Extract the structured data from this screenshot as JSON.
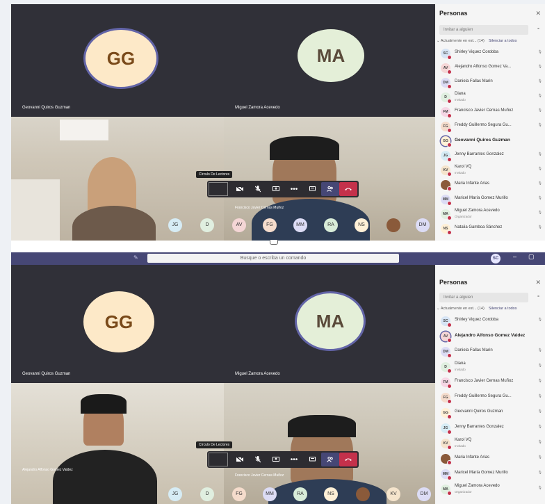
{
  "screenshot_top": {
    "tiles": [
      {
        "initials": "GG",
        "name": "Geovanni Quiros Guzman"
      },
      {
        "initials": "MA",
        "name": "Miguel Zamora Acevedo"
      }
    ],
    "camera_names": {
      "right": "Francisco Javier Cernas Muñoz"
    },
    "tooltip": "Círculo De Lectores",
    "strip": [
      "JG",
      "D",
      "AV",
      "FG",
      "MM",
      "RA",
      "NS",
      "DM"
    ]
  },
  "screenshot_bottom": {
    "search_placeholder": "Busque o escriba un comando",
    "me_initials": "SC",
    "tiles": [
      {
        "initials": "GG",
        "name": "Geovanni Quiros Guzman"
      },
      {
        "initials": "MA",
        "name": "Miguel Zamora Acevedo"
      }
    ],
    "camera_names": {
      "left": "Alejandro Alfonso Gomez Valdez",
      "right": "Francisco Javier Cernas Muñoz"
    },
    "tooltip": "Círculo De Lectores",
    "strip": [
      "JG",
      "D",
      "FG",
      "MM",
      "RA",
      "NS",
      "KV",
      "DM"
    ]
  },
  "panel": {
    "title": "Personas",
    "invite_placeholder": "Invitar a alguien",
    "section": "Actualmente en est... (14)",
    "mute_all": "Silenciar a todos",
    "top_people": [
      {
        "initials": "SC",
        "name": "Shirley Viquez Cordoba",
        "color": "#d6e4f5"
      },
      {
        "initials": "AV",
        "name": "Alejandro Alfonso Gomez Va...",
        "color": "#f5d6d6"
      },
      {
        "initials": "DM",
        "name": "Daniela Fallas Marin",
        "color": "#dcdcf5"
      },
      {
        "initials": "D",
        "name": "Diana",
        "sub": "Invitado",
        "color": "#e0efe0"
      },
      {
        "initials": "FM",
        "name": "Francisco Javier Cernas Muñoz",
        "color": "#f5d6e4"
      },
      {
        "initials": "FG",
        "name": "Freddy Guillermo Segura Gu...",
        "color": "#f5dccc"
      },
      {
        "initials": "GG",
        "name": "Geovanni Quiros Guzman",
        "color": "#fff0d6",
        "bold": true
      },
      {
        "initials": "JG",
        "name": "Jenny Barrantes Gonzalez",
        "color": "#d6ecf5"
      },
      {
        "initials": "KV",
        "name": "Karol VQ",
        "sub": "Invitado",
        "color": "#f5e4cc"
      },
      {
        "initials": "",
        "name": "Maria Infante Arias",
        "color": "#8a5a3a"
      },
      {
        "initials": "MM",
        "name": "Maricel María Gomez Murillo",
        "color": "#dcdcf5"
      },
      {
        "initials": "MA",
        "name": "Miguel Zamora Acevedo",
        "sub": "Organizador",
        "color": "#e0efe0"
      },
      {
        "initials": "NS",
        "name": "Natalia Gamboa Sánchez",
        "color": "#fff0d6"
      }
    ],
    "bottom_people": [
      {
        "initials": "SC",
        "name": "Shirley Viquez Cordoba",
        "color": "#d6e4f5"
      },
      {
        "initials": "AV",
        "name": "Alejandro Alfonso Gomez Valdez",
        "color": "#f5d6d6",
        "bold": true
      },
      {
        "initials": "DM",
        "name": "Daniela Fallas Marin",
        "color": "#dcdcf5"
      },
      {
        "initials": "D",
        "name": "Diana",
        "sub": "Invitado",
        "color": "#e0efe0"
      },
      {
        "initials": "FM",
        "name": "Francisco Javier Cernas Muñoz",
        "color": "#f5d6e4"
      },
      {
        "initials": "FG",
        "name": "Freddy Guillermo Segura Gu...",
        "color": "#f5dccc"
      },
      {
        "initials": "GG",
        "name": "Geovanni Quiros Guzman",
        "color": "#fff0d6"
      },
      {
        "initials": "JG",
        "name": "Jenny Barrantes Gonzalez",
        "color": "#d6ecf5"
      },
      {
        "initials": "KV",
        "name": "Karol VQ",
        "sub": "Invitado",
        "color": "#f5e4cc"
      },
      {
        "initials": "",
        "name": "Maria Infante Arias",
        "color": "#8a5a3a"
      },
      {
        "initials": "MM",
        "name": "Maricel María Gomez Murillo",
        "color": "#dcdcf5"
      },
      {
        "initials": "MA",
        "name": "Miguel Zamora Acevedo",
        "sub": "Organizador",
        "color": "#e0efe0"
      }
    ]
  }
}
